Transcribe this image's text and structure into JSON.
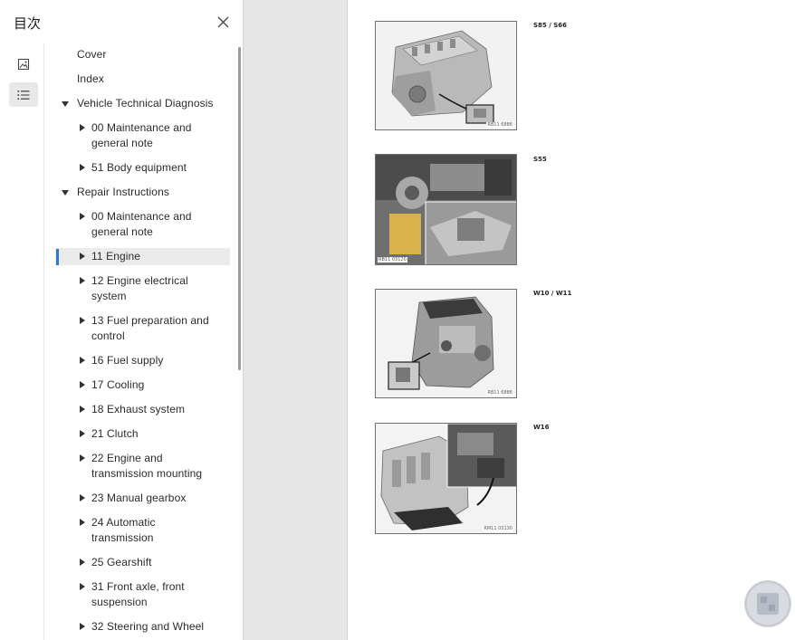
{
  "sidebar": {
    "title": "目次",
    "close_icon": "close-icon",
    "rail": [
      {
        "name": "thumbnails",
        "icon": "image-icon",
        "active": false
      },
      {
        "name": "outline",
        "icon": "list-icon",
        "active": true
      }
    ],
    "toc": [
      {
        "label": "Cover",
        "level": 0,
        "expander": "none"
      },
      {
        "label": "Index",
        "level": 0,
        "expander": "none"
      },
      {
        "label": "Vehicle Technical Diagnosis",
        "level": 0,
        "expander": "expanded"
      },
      {
        "label": "00 Maintenance and general note",
        "lines": [
          "00 Maintenance and",
          "general note"
        ],
        "level": 1,
        "expander": "collapsed"
      },
      {
        "label": "51 Body equipment",
        "level": 1,
        "expander": "collapsed"
      },
      {
        "label": "Repair Instructions",
        "level": 0,
        "expander": "expanded"
      },
      {
        "label": "00 Maintenance and general note",
        "lines": [
          "00 Maintenance and",
          "general note"
        ],
        "level": 1,
        "expander": "collapsed"
      },
      {
        "label": "11 Engine",
        "level": 1,
        "expander": "collapsed",
        "selected": true
      },
      {
        "label": "12 Engine electrical system",
        "lines": [
          "12 Engine electrical",
          "system"
        ],
        "level": 1,
        "expander": "collapsed"
      },
      {
        "label": "13 Fuel preparation and control",
        "lines": [
          "13 Fuel preparation and",
          "control"
        ],
        "level": 1,
        "expander": "collapsed"
      },
      {
        "label": "16 Fuel supply",
        "level": 1,
        "expander": "collapsed"
      },
      {
        "label": "17 Cooling",
        "level": 1,
        "expander": "collapsed"
      },
      {
        "label": "18 Exhaust system",
        "level": 1,
        "expander": "collapsed"
      },
      {
        "label": "21 Clutch",
        "level": 1,
        "expander": "collapsed"
      },
      {
        "label": "22 Engine and transmission mounting",
        "lines": [
          "22 Engine and",
          "transmission mounting"
        ],
        "level": 1,
        "expander": "collapsed"
      },
      {
        "label": "23 Manual gearbox",
        "level": 1,
        "expander": "collapsed"
      },
      {
        "label": "24 Automatic transmission",
        "lines": [
          "24 Automatic",
          "transmission"
        ],
        "level": 1,
        "expander": "collapsed"
      },
      {
        "label": "25 Gearshift",
        "level": 1,
        "expander": "collapsed"
      },
      {
        "label": "31 Front axle, front suspension",
        "lines": [
          "31 Front axle, front",
          "suspension"
        ],
        "level": 1,
        "expander": "collapsed"
      },
      {
        "label": "32 Steering and Wheel",
        "level": 1,
        "expander": "collapsed"
      }
    ]
  },
  "page": {
    "figures": [
      {
        "label": "S85 / S66",
        "code": "RB11 6886"
      },
      {
        "label": "S55",
        "code": "RB11 03120"
      },
      {
        "label": "W10 / W11",
        "code": "RB11 6886"
      },
      {
        "label": "W16",
        "code": "RM11 03130"
      }
    ]
  },
  "colors": {
    "accent": "#2a7bd4",
    "selection_bg": "#ebebeb",
    "viewer_bg": "#e6e6e6"
  }
}
